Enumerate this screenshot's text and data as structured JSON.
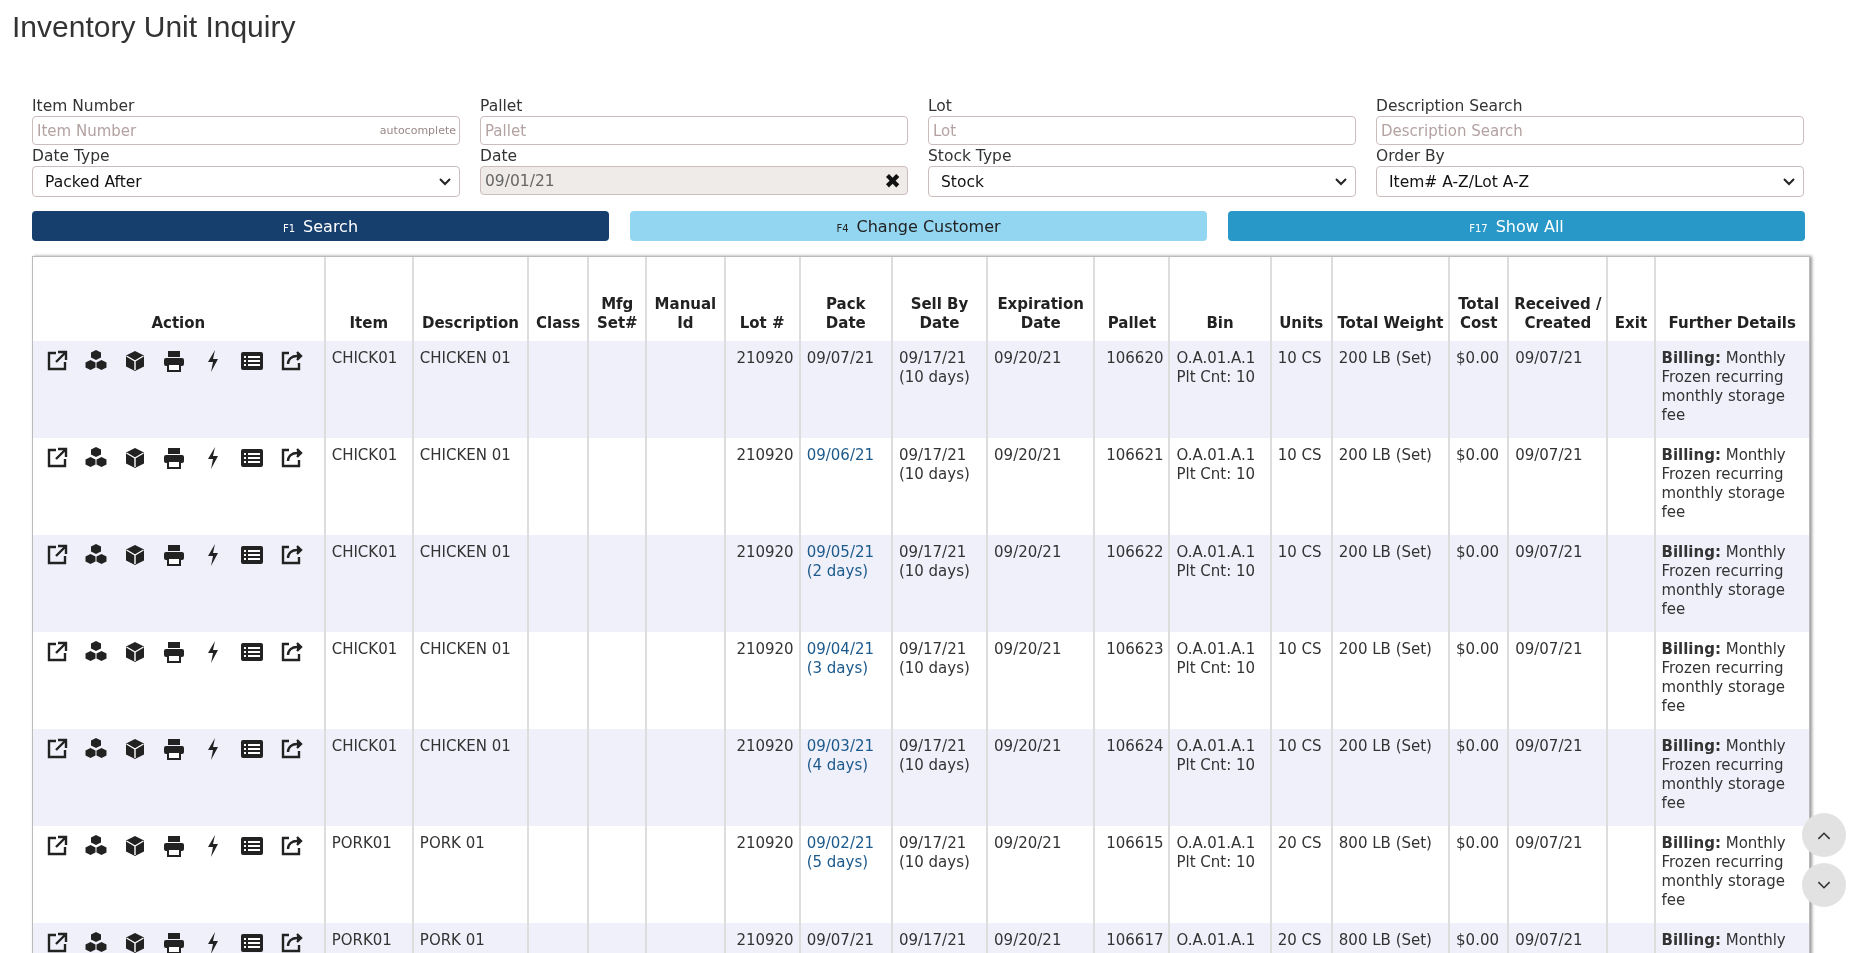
{
  "page": {
    "title": "Inventory Unit Inquiry"
  },
  "filters": [
    {
      "label": "Item Number",
      "kind": "text",
      "placeholder": "Item Number",
      "badge": "autocomplete"
    },
    {
      "label": "Pallet",
      "kind": "text",
      "placeholder": "Pallet"
    },
    {
      "label": "Lot",
      "kind": "text",
      "placeholder": "Lot"
    },
    {
      "label": "Description Search",
      "kind": "text",
      "placeholder": "Description Search"
    },
    {
      "label": "Date Type",
      "kind": "select",
      "value": "Packed After"
    },
    {
      "label": "Date",
      "kind": "date",
      "value": "09/01/21",
      "clear": "✖"
    },
    {
      "label": "Stock Type",
      "kind": "select",
      "value": "Stock"
    },
    {
      "label": "Order By",
      "kind": "select",
      "value": "Item# A-Z/Lot A-Z"
    }
  ],
  "buttons": [
    {
      "key": "F1",
      "label": "Search",
      "kind": "primary"
    },
    {
      "key": "F4",
      "label": "Change Customer",
      "kind": "secondary"
    },
    {
      "key": "F17",
      "label": "Show All",
      "kind": "info"
    }
  ],
  "table": {
    "columns": [
      "Action",
      "Item",
      "Description",
      "Class",
      "Mfg Set#",
      "Manual Id",
      "Lot #",
      "Pack Date",
      "Sell By Date",
      "Expiration Date",
      "Pallet",
      "Bin",
      "Units",
      "Total Weight",
      "Total Cost",
      "Received / Created",
      "Exit",
      "Further Details"
    ],
    "rows": [
      {
        "item": "CHICK01",
        "description": "CHICKEN 01",
        "lot": "210920",
        "pack_date": "09/07/21",
        "linked": false,
        "sell_by": "09/17/21",
        "sell_by_note": "(10 days)",
        "expiration": "09/20/21",
        "pallet": "106620",
        "bin": "O.A.01.A.1",
        "plt_cnt": "Plt Cnt: 10",
        "units": "10 CS",
        "weight": "200 LB (Set)",
        "cost": "$0.00",
        "received": "09/07/21",
        "details": "**Billing:** Monthly Frozen recurring monthly storage fee"
      },
      {
        "item": "CHICK01",
        "description": "CHICKEN 01",
        "lot": "210920",
        "pack_date": "09/06/21",
        "linked": true,
        "sell_by": "09/17/21",
        "sell_by_note": "(10 days)",
        "expiration": "09/20/21",
        "pallet": "106621",
        "bin": "O.A.01.A.1",
        "plt_cnt": "Plt Cnt: 10",
        "units": "10 CS",
        "weight": "200 LB (Set)",
        "cost": "$0.00",
        "received": "09/07/21",
        "details": "**Billing:** Monthly Frozen recurring monthly storage fee"
      },
      {
        "item": "CHICK01",
        "description": "CHICKEN 01",
        "lot": "210920",
        "pack_date": "09/05/21",
        "pack_note": "(2 days)",
        "linked": true,
        "sell_by": "09/17/21",
        "sell_by_note": "(10 days)",
        "expiration": "09/20/21",
        "pallet": "106622",
        "bin": "O.A.01.A.1",
        "plt_cnt": "Plt Cnt: 10",
        "units": "10 CS",
        "weight": "200 LB (Set)",
        "cost": "$0.00",
        "received": "09/07/21",
        "details": "**Billing:** Monthly Frozen recurring monthly storage fee"
      },
      {
        "item": "CHICK01",
        "description": "CHICKEN 01",
        "lot": "210920",
        "pack_date": "09/04/21",
        "pack_note": "(3 days)",
        "linked": true,
        "sell_by": "09/17/21",
        "sell_by_note": "(10 days)",
        "expiration": "09/20/21",
        "pallet": "106623",
        "bin": "O.A.01.A.1",
        "plt_cnt": "Plt Cnt: 10",
        "units": "10 CS",
        "weight": "200 LB (Set)",
        "cost": "$0.00",
        "received": "09/07/21",
        "details": "**Billing:** Monthly Frozen recurring monthly storage fee"
      },
      {
        "item": "CHICK01",
        "description": "CHICKEN 01",
        "lot": "210920",
        "pack_date": "09/03/21",
        "pack_note": "(4 days)",
        "linked": true,
        "sell_by": "09/17/21",
        "sell_by_note": "(10 days)",
        "expiration": "09/20/21",
        "pallet": "106624",
        "bin": "O.A.01.A.1",
        "plt_cnt": "Plt Cnt: 10",
        "units": "10 CS",
        "weight": "200 LB (Set)",
        "cost": "$0.00",
        "received": "09/07/21",
        "details": "**Billing:** Monthly Frozen recurring monthly storage fee"
      },
      {
        "item": "PORK01",
        "description": "PORK 01",
        "lot": "210920",
        "pack_date": "09/02/21",
        "pack_note": "(5 days)",
        "linked": true,
        "sell_by": "09/17/21",
        "sell_by_note": "(10 days)",
        "expiration": "09/20/21",
        "pallet": "106615",
        "bin": "O.A.01.A.1",
        "plt_cnt": "Plt Cnt: 10",
        "units": "20 CS",
        "weight": "800 LB (Set)",
        "cost": "$0.00",
        "received": "09/07/21",
        "details": "**Billing:** Monthly Frozen recurring monthly storage fee"
      },
      {
        "item": "PORK01",
        "description": "PORK 01",
        "lot": "210920",
        "pack_date": "09/07/21",
        "linked": false,
        "sell_by": "09/17/21",
        "expiration": "09/20/21",
        "pallet": "106617",
        "bin": "O.A.01.A.1",
        "units": "20 CS",
        "weight": "800 LB (Set)",
        "cost": "$0.00",
        "received": "09/07/21",
        "details": "**Billing:** Monthly"
      }
    ]
  }
}
